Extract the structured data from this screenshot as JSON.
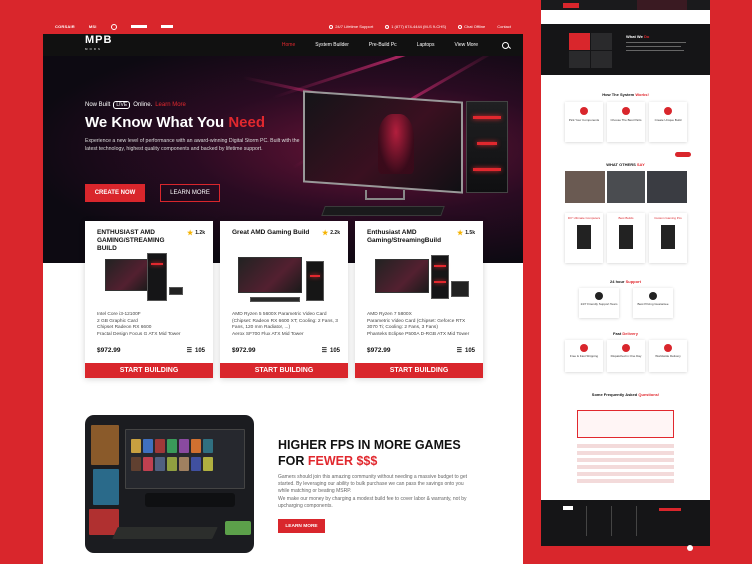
{
  "topbar": {
    "brands": [
      "CORSAIR",
      "MSI",
      "",
      "",
      ""
    ],
    "support": "24/7 Lifetime Support",
    "phone": "1 (877) 674-4444 (M-S 9-CHS)",
    "chat": "Chat Offline",
    "contact": "Contact"
  },
  "nav": {
    "logo": "MPB",
    "logo_sub": "MODS",
    "links": [
      "Home",
      "System Builder",
      "Pre-Build Pc",
      "Laptops",
      "View More"
    ],
    "active": "Home"
  },
  "hero": {
    "sub_before": "Now Built",
    "sub_badge": "LIVE",
    "sub_after": "Online.",
    "sub_link": "Learn More",
    "title_white": "We Know What You",
    "title_red": "Need",
    "description": "Experience a new level of performance with an award-winning Digital Storm PC. Built with the latest technology, highest quality components and backed by lifetime support.",
    "primary_button": "CREATE NOW",
    "secondary_button": "LEARN MORE",
    "slides": 4,
    "active_slide": 0
  },
  "products": [
    {
      "title": "ENTHUSIAST AMD GAMING/STREAMING BUILD",
      "rating": "1.2k",
      "specs": "Intel Core i3-12100F\n2 GB Graphic Card\nChipset Radeon RX 6600\nFractal Design Focus G ATX Mid Tower",
      "price": "$972.99",
      "count": "105",
      "button": "START BUILDING"
    },
    {
      "title": "Great AMD Gaming Build",
      "rating": "2.2k",
      "specs": "AMD Ryzen 5 5600X Parametric Video Card (Chipset: Radeon RX 6600 XT; Cooling: 2 Fans, 3 Fans, 120 mm Radiator, ...)\nAerox SF700 Flux ATX Mid Tower",
      "price": "$972.99",
      "count": "105",
      "button": "START BUILDING"
    },
    {
      "title": "Enthusiast AMD Gaming/StreamingBuild",
      "rating": "1.5k",
      "specs": "AMD Ryzen 7 5800X\nParametric Video Card (Chipset: Geforce RTX 3070 Ti; Cooling: 2 Fans, 3 Fans)\nPhanteks Eclipse P500A D-RGB ATX Mid Tower",
      "price": "$972.99",
      "count": "105",
      "button": "START BUILDING"
    }
  ],
  "fps": {
    "title_line1": "HIGHER FPS IN MORE GAMES",
    "title_prefix": "FOR",
    "title_red": "FEWER $$$",
    "body": "Gamers should join this amazing community without needing a massive budget to get started. By leveraging our ability to bulk purchase we can pass the savings onto you while matching or beating MSRP.\nWe make our money by charging a modest build fee to cover labor & warranty, not by upcharging components.",
    "button": "LEARN MORE"
  },
  "side": {
    "about_title_white": "What We",
    "about_title_red": "Do",
    "how_title": "How The System",
    "how_title_red": "Works!",
    "how_items": [
      "Pick Your Components",
      "Choose The Best Parts",
      "Create Unique Build"
    ],
    "others_title": "WHAT OTHERS",
    "others_title_red": "SAY",
    "builds": [
      "DIY Ultimate Computers",
      "Best Builds",
      "Custom Gaming Pcs"
    ],
    "support_title": "24 hour",
    "support_title_red": "Support",
    "support_items": [
      "24/7 Friendly Support Team",
      "Best Pricing Guarantee"
    ],
    "delivery_title": "Fast",
    "delivery_title_red": "Delivery",
    "delivery_items": [
      "Free & Fast Shipping",
      "Dispatched in One Day",
      "Worldwide Delivery"
    ],
    "faq_title": "Some Frequently Asked",
    "faq_title_red": "Questions!"
  },
  "colors": {
    "brand_red": "#d9262c",
    "dark": "#111111"
  }
}
